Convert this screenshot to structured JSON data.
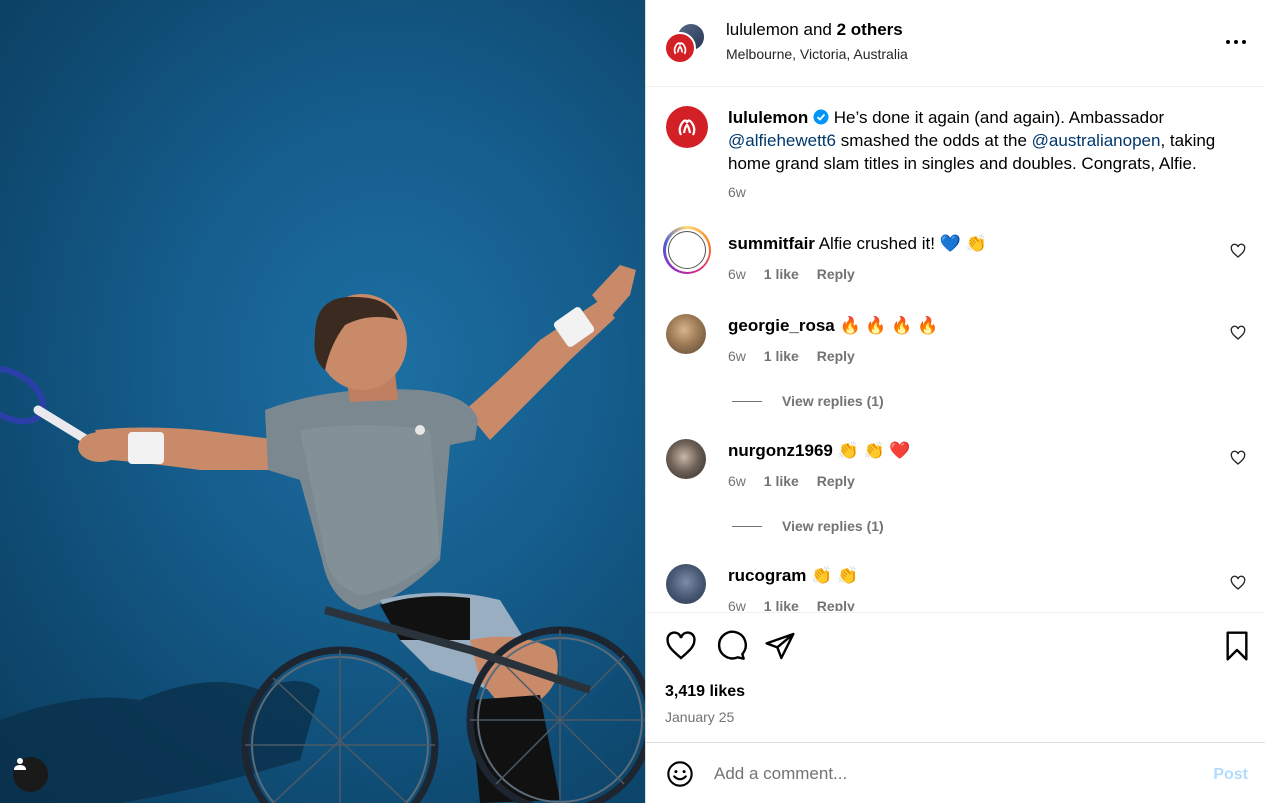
{
  "header": {
    "account": "lululemon",
    "joiner": "and",
    "others": "2 others",
    "location": "Melbourne, Victoria, Australia"
  },
  "caption": {
    "username": "lululemon",
    "text_1": "He’s done it again (and again). Ambassador",
    "mention_1": "@alfiehewett6",
    "text_2": "smashed the odds at the",
    "mention_2": "@australianopen",
    "text_3": ", taking home grand slam titles in singles and doubles. Congrats, Alfie.",
    "time": "6w"
  },
  "comments": [
    {
      "username": "summitfair",
      "text": "Alfie crushed it! 💙 👏",
      "time": "6w",
      "likes": "1 like",
      "reply": "Reply"
    },
    {
      "username": "georgie_rosa",
      "text": "🔥 🔥 🔥 🔥",
      "time": "6w",
      "likes": "1 like",
      "reply": "Reply",
      "view_replies": "View replies (1)"
    },
    {
      "username": "nurgonz1969",
      "text": "👏 👏 ❤️",
      "time": "6w",
      "likes": "1 like",
      "reply": "Reply",
      "view_replies": "View replies (1)"
    },
    {
      "username": "rucogram",
      "text": "👏 👏",
      "time": "6w",
      "likes": "1 like",
      "reply": "Reply"
    }
  ],
  "stats": {
    "likes": "3,419 likes",
    "date": "January 25"
  },
  "composer": {
    "placeholder": "Add a comment...",
    "post_label": "Post"
  },
  "colors": {
    "brand_red": "#d31f26",
    "link": "#00376b",
    "muted": "#737373",
    "post_disabled": "#b3dbff"
  },
  "icons": {
    "more": "more-horizontal-icon",
    "like": "heart-icon",
    "comment": "comment-icon",
    "share": "send-icon",
    "save": "bookmark-icon",
    "emoji": "emoji-icon",
    "tag": "user-tag-icon"
  }
}
